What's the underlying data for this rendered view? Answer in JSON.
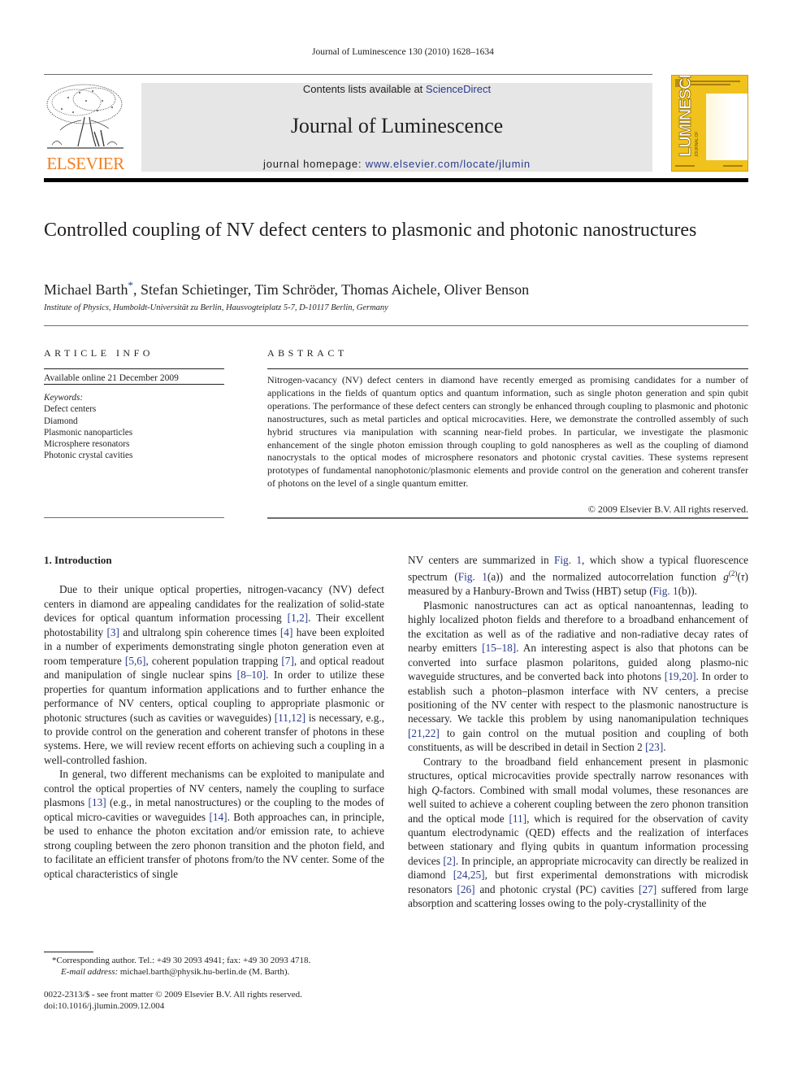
{
  "header": {
    "running_head": "Journal of Luminescence 130 (2010) 1628–1634",
    "publisher_logo_text": "ELSEVIER",
    "contents_prefix": "Contents lists available at ",
    "contents_link": "ScienceDirect",
    "journal_name": "Journal of Luminescence",
    "homepage_prefix": "journal homepage: ",
    "homepage_link": "www.elsevier.com/locate/jlumin",
    "cover_title": "LUMINESCENCE",
    "cover_subtitle": "JOURNAL OF"
  },
  "article": {
    "title": "Controlled coupling of NV defect centers to plasmonic and photonic nanostructures",
    "authors_first": "Michael Barth",
    "authors_mark": "*",
    "authors_rest": ", Stefan Schietinger, Tim Schröder, Thomas Aichele, Oliver Benson",
    "affiliation": "Institute of Physics, Humboldt-Universität zu Berlin, Hausvogteiplatz 5-7, D-10117 Berlin, Germany"
  },
  "article_info": {
    "heading": "ARTICLE INFO",
    "available_online": "Available online 21 December 2009",
    "keywords_label": "Keywords:",
    "keywords": [
      "Defect centers",
      "Diamond",
      "Plasmonic nanoparticles",
      "Microsphere resonators",
      "Photonic crystal cavities"
    ]
  },
  "abstract": {
    "heading": "ABSTRACT",
    "text": "Nitrogen-vacancy (NV) defect centers in diamond have recently emerged as promising candidates for a number of applications in the fields of quantum optics and quantum information, such as single photon generation and spin qubit operations. The performance of these defect centers can strongly be enhanced through coupling to plasmonic and photonic nanostructures, such as metal particles and optical microcavities. Here, we demonstrate the controlled assembly of such hybrid structures via manipulation with scanning near-field probes. In particular, we investigate the plasmonic enhancement of the single photon emission through coupling to gold nanospheres as well as the coupling of diamond nanocrystals to the optical modes of microsphere resonators and photonic crystal cavities. These systems represent prototypes of fundamental nanophotonic/plasmonic elements and provide control on the generation and coherent transfer of photons on the level of a single quantum emitter.",
    "copyright": "© 2009 Elsevier B.V. All rights reserved."
  },
  "body": {
    "section_title": "1.  Introduction",
    "p1": [
      {
        "t": "Due to their unique optical properties, nitrogen-vacancy (NV) defect centers in diamond are appealing candidates for the realization of solid-state devices for optical quantum information processing "
      },
      {
        "c": "[1,2]"
      },
      {
        "t": ". Their excellent photostability "
      },
      {
        "c": "[3]"
      },
      {
        "t": " and ultralong spin coherence times "
      },
      {
        "c": "[4]"
      },
      {
        "t": " have been exploited in a number of experiments demonstrating single photon generation even at room temperature "
      },
      {
        "c": "[5,6]"
      },
      {
        "t": ", coherent population trapping "
      },
      {
        "c": "[7]"
      },
      {
        "t": ", and optical readout and manipulation of single nuclear spins "
      },
      {
        "c": "[8–10]"
      },
      {
        "t": ". In order to utilize these properties for quantum information applications and to further enhance the performance of NV centers, optical coupling to appropriate plasmonic or photonic structures (such as cavities or waveguides) "
      },
      {
        "c": "[11,12]"
      },
      {
        "t": " is necessary, e.g., to provide control on the generation and coherent transfer of photons in these systems. Here, we will review recent efforts on achieving such a coupling in a well-controlled fashion."
      }
    ],
    "p2": [
      {
        "t": "In general, two different mechanisms can be exploited to manipulate and control the optical properties of NV centers, namely the coupling to surface plasmons "
      },
      {
        "c": "[13]"
      },
      {
        "t": " (e.g., in metal nanostructures) or the coupling to the modes of optical micro-cavities or waveguides "
      },
      {
        "c": "[14]"
      },
      {
        "t": ". Both approaches can, in principle, be used to enhance the photon excitation and/or emission rate, to achieve strong coupling between the zero phonon transition and the photon field, and to facilitate an efficient transfer of photons from/to the NV center. Some of the optical characteristics of single"
      }
    ],
    "p3": [
      {
        "t": "NV centers are summarized in "
      },
      {
        "c": "Fig. 1"
      },
      {
        "t": ", which show a typical fluorescence spectrum ("
      },
      {
        "c": "Fig. 1"
      },
      {
        "t": "(a)) and the normalized autocorrelation function "
      },
      {
        "i": "g"
      },
      {
        "s": "(2)"
      },
      {
        "t": "("
      },
      {
        "i": "τ"
      },
      {
        "t": ") measured by a Hanbury-Brown and Twiss (HBT) setup ("
      },
      {
        "c": "Fig. 1"
      },
      {
        "t": "(b))."
      }
    ],
    "p4": [
      {
        "t": "Plasmonic nanostructures can act as optical nanoantennas, leading to highly localized photon fields and therefore to a broadband enhancement of the excitation as well as of the radiative and non-radiative decay rates of nearby emitters "
      },
      {
        "c": "[15–18]"
      },
      {
        "t": ". An interesting aspect is also that photons can be converted into surface plasmon polaritons, guided along plasmo-nic waveguide structures, and be converted back into photons "
      },
      {
        "c": "[19,20]"
      },
      {
        "t": ". In order to establish such a photon–plasmon interface with NV centers, a precise positioning of the NV center with respect to the plasmonic nanostructure is necessary. We tackle this problem by using nanomanipulation techniques "
      },
      {
        "c": "[21,22]"
      },
      {
        "t": " to gain control on the mutual position and coupling of both constituents, as will be described in detail in Section 2 "
      },
      {
        "c": "[23]"
      },
      {
        "t": "."
      }
    ],
    "p5": [
      {
        "t": "Contrary to the broadband field enhancement present in plasmonic structures, optical microcavities provide spectrally narrow resonances with high "
      },
      {
        "i": "Q"
      },
      {
        "t": "-factors. Combined with small modal volumes, these resonances are well suited to achieve a coherent coupling between the zero phonon transition and the optical mode "
      },
      {
        "c": "[11]"
      },
      {
        "t": ", which is required for the observation of cavity quantum electrodynamic (QED) effects and the realization of interfaces between stationary and flying qubits in quantum information processing devices "
      },
      {
        "c": "[2]"
      },
      {
        "t": ". In principle, an appropriate microcavity can directly be realized in diamond "
      },
      {
        "c": "[24,25]"
      },
      {
        "t": ", but first experimental demonstrations with microdisk resonators "
      },
      {
        "c": "[26]"
      },
      {
        "t": " and photonic crystal (PC) cavities "
      },
      {
        "c": "[27]"
      },
      {
        "t": " suffered from large absorption and scattering losses owing to the poly-crystallinity of the"
      }
    ]
  },
  "footnote": {
    "line1": "*Corresponding author. Tel.: +49 30 2093 4941; fax: +49 30 2093 4718.",
    "email_label": "E-mail address:",
    "email_value": " michael.barth@physik.hu-berlin.de (M. Barth)."
  },
  "front_matter": {
    "issn_line": "0022-2313/$ - see front matter © 2009 Elsevier B.V. All rights reserved.",
    "doi": "doi:10.1016/j.jlumin.2009.12.004"
  }
}
